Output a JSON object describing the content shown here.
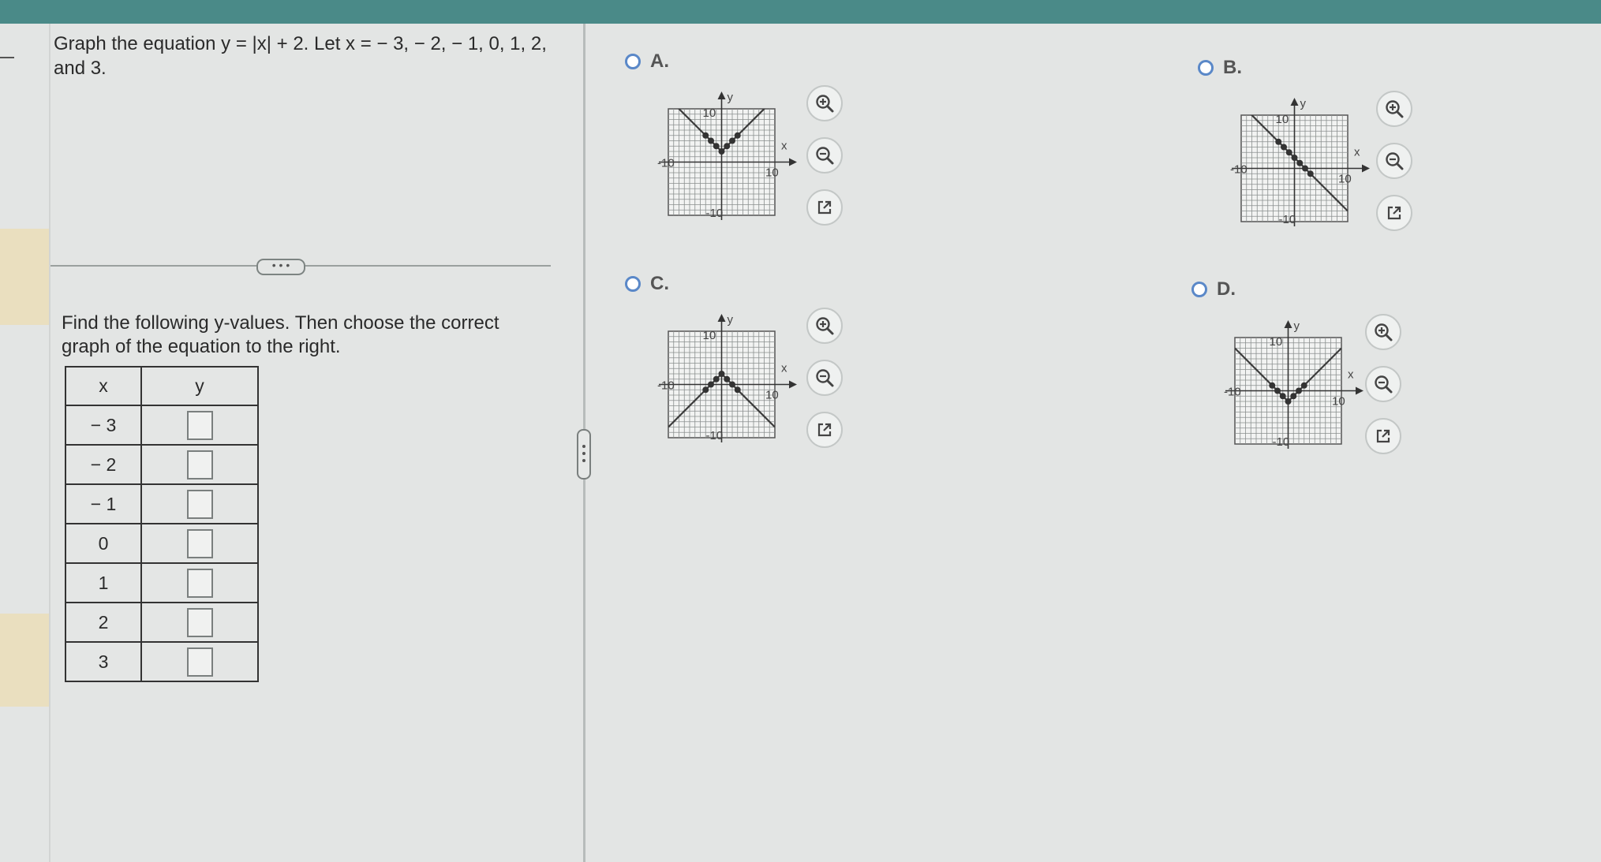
{
  "question": "Graph the equation y = |x| + 2. Let x = − 3, − 2, − 1, 0, 1, 2, and 3.",
  "more_button": "• • •",
  "instructions": "Find the following y-values. Then choose the correct graph of the equation to the right.",
  "table": {
    "headers": [
      "x",
      "y"
    ],
    "rows": [
      {
        "x": "− 3",
        "y": ""
      },
      {
        "x": "− 2",
        "y": ""
      },
      {
        "x": "− 1",
        "y": ""
      },
      {
        "x": "0",
        "y": ""
      },
      {
        "x": "1",
        "y": ""
      },
      {
        "x": "2",
        "y": ""
      },
      {
        "x": "3",
        "y": ""
      }
    ]
  },
  "graph_labels": {
    "y_axis": "y",
    "x_axis": "x",
    "ten": "10",
    "neg_ten": "-10"
  },
  "options": [
    {
      "letter": "A.",
      "line": [
        [
          -10,
          12
        ],
        [
          0,
          2
        ],
        [
          10,
          12
        ]
      ],
      "points": [
        [
          -3,
          5
        ],
        [
          -2,
          4
        ],
        [
          -1,
          3
        ],
        [
          0,
          2
        ],
        [
          1,
          3
        ],
        [
          2,
          4
        ],
        [
          3,
          5
        ]
      ]
    },
    {
      "letter": "B.",
      "line": [
        [
          -10,
          12
        ],
        [
          10,
          -8
        ]
      ],
      "points": [
        [
          -3,
          5
        ],
        [
          -2,
          4
        ],
        [
          -1,
          3
        ],
        [
          0,
          2
        ],
        [
          1,
          1
        ],
        [
          2,
          0
        ],
        [
          3,
          -1
        ]
      ]
    },
    {
      "letter": "C.",
      "line": [
        [
          -10,
          -8
        ],
        [
          0,
          2
        ],
        [
          10,
          -8
        ]
      ],
      "points": [
        [
          -3,
          -1
        ],
        [
          -2,
          0
        ],
        [
          -1,
          1
        ],
        [
          0,
          2
        ],
        [
          1,
          1
        ],
        [
          2,
          0
        ],
        [
          3,
          -1
        ]
      ]
    },
    {
      "letter": "D.",
      "line": [
        [
          -10,
          8
        ],
        [
          0,
          -2
        ],
        [
          10,
          8
        ]
      ],
      "points": [
        [
          -3,
          1
        ],
        [
          -2,
          0
        ],
        [
          -1,
          -1
        ],
        [
          0,
          -2
        ],
        [
          1,
          -1
        ],
        [
          2,
          0
        ],
        [
          3,
          1
        ]
      ]
    }
  ],
  "icons": {
    "zoom_in": "zoom-in-icon",
    "zoom_out": "zoom-out-icon",
    "popout": "popout-icon"
  },
  "colors": {
    "accent_bar": "#4a8a88",
    "radio": "#5a88c8",
    "side_strip": "#eadfbf",
    "graph_line": "#3a3a3a"
  }
}
